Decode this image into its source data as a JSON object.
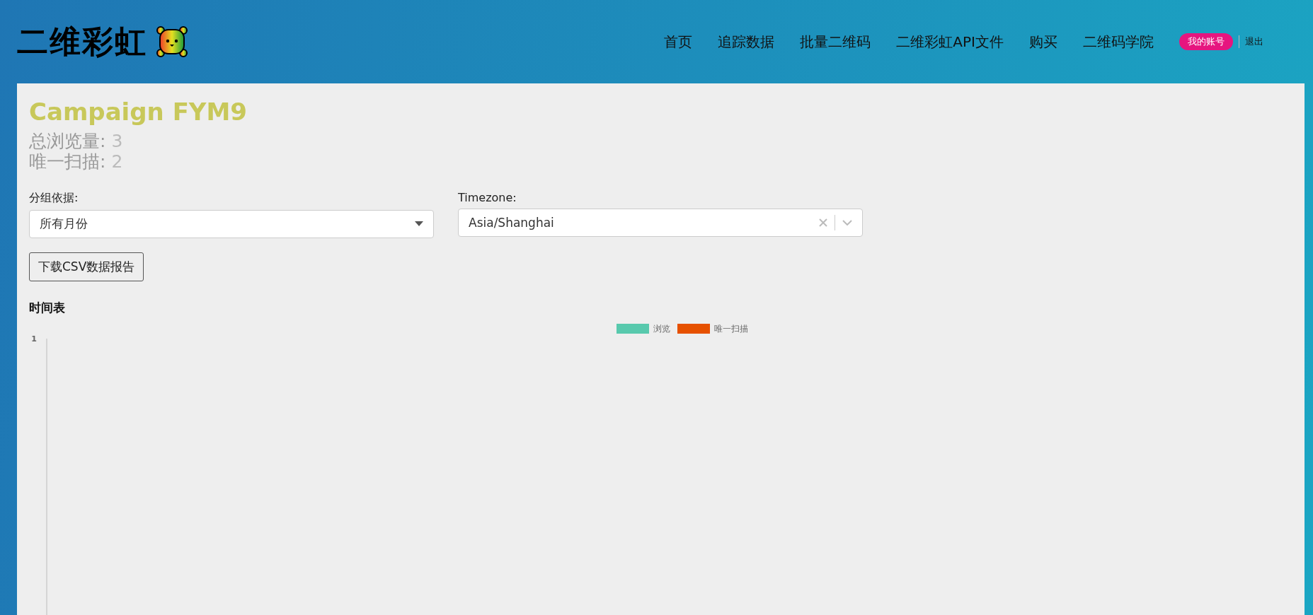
{
  "header": {
    "logo": "二维彩虹",
    "nav": [
      {
        "label": "首页"
      },
      {
        "label": "追踪数据"
      },
      {
        "label": "批量二维码"
      },
      {
        "label": "二维彩虹API文件"
      },
      {
        "label": "购买"
      },
      {
        "label": "二维码学院"
      }
    ],
    "account": "我的账号",
    "logout": "退出"
  },
  "campaign": {
    "title": "Campaign FYM9",
    "stats": [
      {
        "label": "总浏览量:",
        "value": "3"
      },
      {
        "label": "唯一扫描:",
        "value": "2"
      }
    ]
  },
  "group_by": {
    "label": "分组依据:",
    "value": "所有月份"
  },
  "timezone": {
    "label": "Timezone:",
    "value": "Asia/Shanghai"
  },
  "download_button": "下载CSV数据报告",
  "timeline": {
    "title": "时间表",
    "legend": [
      {
        "name": "浏览",
        "color": "#58c9ad"
      },
      {
        "name": "唯一扫描",
        "color": "#e65100"
      }
    ],
    "axis_label": "1"
  }
}
